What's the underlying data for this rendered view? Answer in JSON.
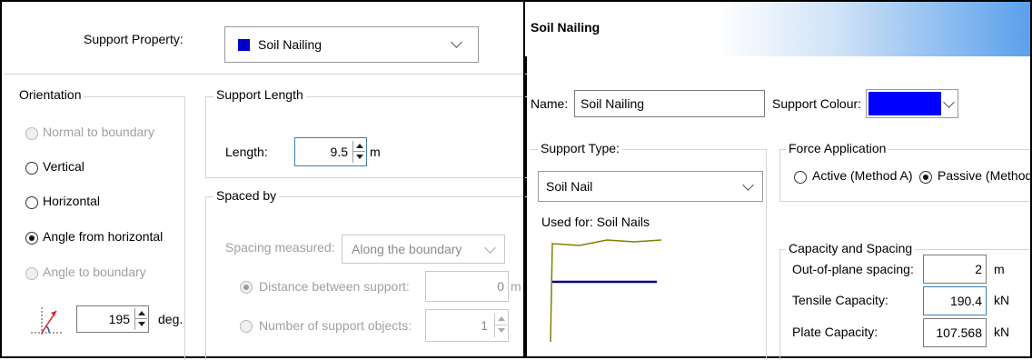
{
  "left": {
    "support_property_label": "Support Property:",
    "support_property_value": "Soil Nailing",
    "support_property_color": "#0000c8",
    "orientation": {
      "title": "Orientation",
      "options": [
        "Normal to boundary",
        "Vertical",
        "Horizontal",
        "Angle from horizontal",
        "Angle to boundary"
      ],
      "selected": "Angle from horizontal",
      "angle_value": "195",
      "angle_unit": "deg."
    },
    "support_length": {
      "title": "Support Length",
      "length_label": "Length:",
      "length_value": "9.5",
      "length_unit": "m"
    },
    "spaced_by": {
      "title": "Spaced by",
      "spacing_measured_label": "Spacing measured:",
      "spacing_measured_value": "Along the boundary",
      "distance_label": "Distance between support:",
      "distance_value": "0",
      "distance_unit": "m",
      "number_label": "Number of support objects:",
      "number_value": "1"
    }
  },
  "right": {
    "title": "Soil Nailing",
    "name_label": "Name:",
    "name_value": "Soil Nailing",
    "support_colour_label": "Support Colour:",
    "support_colour": "#0000ff",
    "support_type": {
      "title": "Support Type:",
      "value": "Soil Nail",
      "used_for": "Used for: Soil Nails"
    },
    "force_application": {
      "title": "Force Application",
      "options": [
        "Active (Method A)",
        "Passive (Method B)"
      ],
      "selected": "Passive (Method B)"
    },
    "capacity": {
      "title": "Capacity and Spacing",
      "out_of_plane_label": "Out-of-plane spacing:",
      "out_of_plane_value": "2",
      "out_of_plane_unit": "m",
      "tensile_label": "Tensile Capacity:",
      "tensile_value": "190.4",
      "tensile_unit": "kN",
      "plate_label": "Plate Capacity:",
      "plate_value": "107.568",
      "plate_unit": "kN"
    }
  },
  "icons": [
    "angle-icon",
    "soil-nail-preview-icon"
  ]
}
